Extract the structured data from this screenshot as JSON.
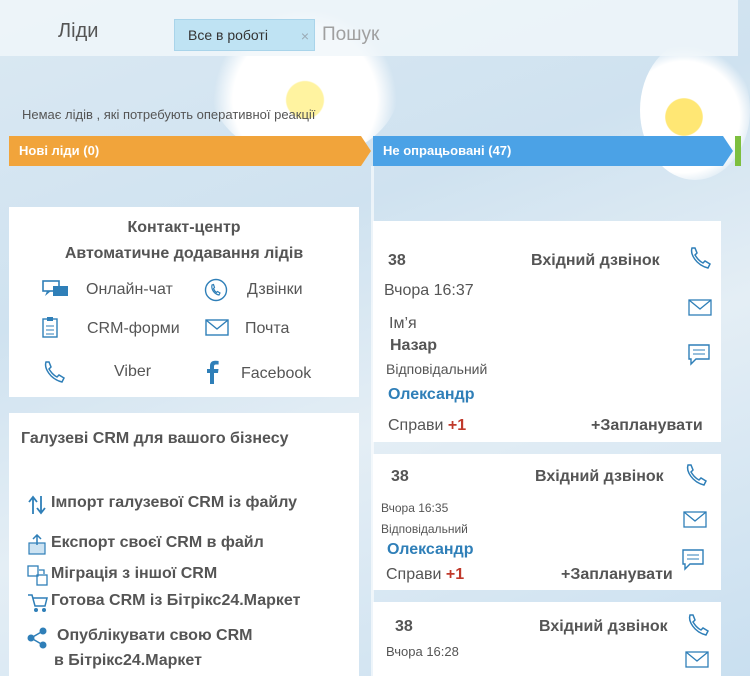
{
  "header": {
    "title": "Ліди",
    "filter_tag": "Все в роботі",
    "filter_close": "×",
    "search_placeholder": "Пошук"
  },
  "notice": "Немає лідів , які потребують оперативної реакції",
  "stages": [
    {
      "label": "Нові ліди (0)",
      "color": "#f1a43b"
    },
    {
      "label": "Не опрацьовані (47)",
      "color": "#4ba2e6"
    }
  ],
  "contact_center": {
    "title": "Контакт-центр",
    "subtitle": "Автоматичне додавання лідів",
    "channels": [
      {
        "label": "Онлайн-чат",
        "icon": "chat-icon"
      },
      {
        "label": "Дзвінки",
        "icon": "phone-circle-icon"
      },
      {
        "label": "CRM-форми",
        "icon": "form-icon"
      },
      {
        "label": "Почта",
        "icon": "mail-icon"
      },
      {
        "label": "Viber",
        "icon": "phone-icon"
      },
      {
        "label": "Facebook",
        "icon": "facebook-icon"
      }
    ]
  },
  "industry": {
    "title": "Галузеві CRM для вашого бізнесу",
    "items": [
      {
        "label": "Імпорт галузевої CRM із файлу",
        "icon": "import-arrows-icon"
      },
      {
        "label": "Експорт своєї CRM в файл",
        "icon": "export-box-icon"
      },
      {
        "label": "Міграція з іншої CRM",
        "icon": "migrate-icon"
      },
      {
        "label": "Готова CRM із Бітрікс24.Маркет",
        "icon": "market-cart-icon"
      },
      {
        "label": "Опублікувати свою CRM",
        "label2": "в Бітрікс24.Маркет",
        "icon": "share-icon"
      }
    ]
  },
  "cards": [
    {
      "id": "38",
      "type": "Вхідний дзвінок",
      "time": "Вчора 16:37",
      "name_label": "Ім’я",
      "name": "Назар",
      "resp_label": "Відповідальний",
      "resp": "Олександр",
      "tasks_label": "Справи",
      "tasks_count": "+1",
      "plan": "+Запланувати"
    },
    {
      "id": "38",
      "type": "Вхідний дзвінок",
      "time": "Вчора 16:35",
      "resp_label": "Відповідальний",
      "resp": "Олександр",
      "tasks_label": "Справи",
      "tasks_count": "+1",
      "plan": "+Запланувати"
    },
    {
      "id": "38",
      "type": "Вхідний дзвінок",
      "time": "Вчора 16:28"
    }
  ],
  "colors": {
    "accent_orange": "#f1a43b",
    "accent_blue": "#4ba2e6",
    "link_blue": "#2f7fb8",
    "count_red": "#c0392b"
  }
}
